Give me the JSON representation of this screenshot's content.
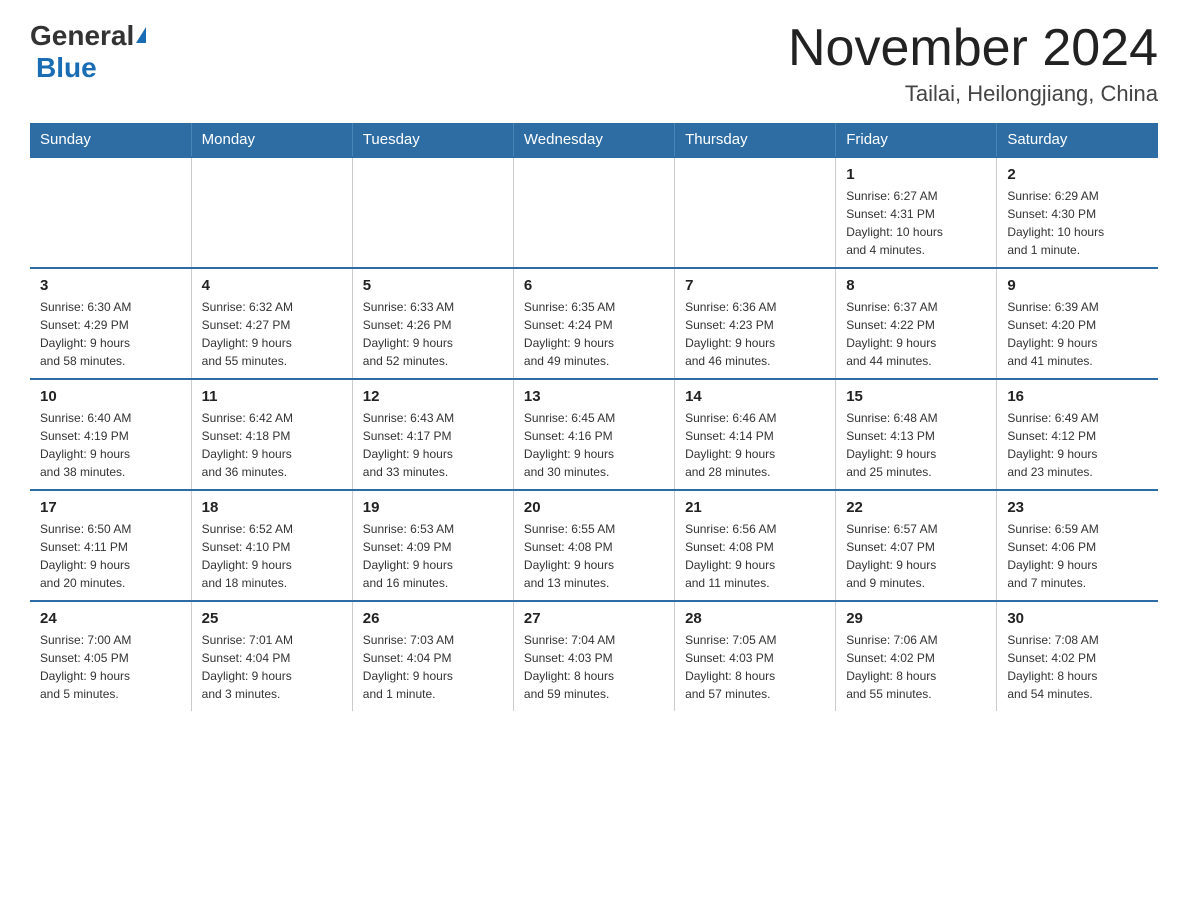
{
  "header": {
    "logo_general": "General",
    "logo_blue": "Blue",
    "month_year": "November 2024",
    "location": "Tailai, Heilongjiang, China"
  },
  "weekdays": [
    "Sunday",
    "Monday",
    "Tuesday",
    "Wednesday",
    "Thursday",
    "Friday",
    "Saturday"
  ],
  "weeks": [
    [
      {
        "day": "",
        "info": ""
      },
      {
        "day": "",
        "info": ""
      },
      {
        "day": "",
        "info": ""
      },
      {
        "day": "",
        "info": ""
      },
      {
        "day": "",
        "info": ""
      },
      {
        "day": "1",
        "info": "Sunrise: 6:27 AM\nSunset: 4:31 PM\nDaylight: 10 hours\nand 4 minutes."
      },
      {
        "day": "2",
        "info": "Sunrise: 6:29 AM\nSunset: 4:30 PM\nDaylight: 10 hours\nand 1 minute."
      }
    ],
    [
      {
        "day": "3",
        "info": "Sunrise: 6:30 AM\nSunset: 4:29 PM\nDaylight: 9 hours\nand 58 minutes."
      },
      {
        "day": "4",
        "info": "Sunrise: 6:32 AM\nSunset: 4:27 PM\nDaylight: 9 hours\nand 55 minutes."
      },
      {
        "day": "5",
        "info": "Sunrise: 6:33 AM\nSunset: 4:26 PM\nDaylight: 9 hours\nand 52 minutes."
      },
      {
        "day": "6",
        "info": "Sunrise: 6:35 AM\nSunset: 4:24 PM\nDaylight: 9 hours\nand 49 minutes."
      },
      {
        "day": "7",
        "info": "Sunrise: 6:36 AM\nSunset: 4:23 PM\nDaylight: 9 hours\nand 46 minutes."
      },
      {
        "day": "8",
        "info": "Sunrise: 6:37 AM\nSunset: 4:22 PM\nDaylight: 9 hours\nand 44 minutes."
      },
      {
        "day": "9",
        "info": "Sunrise: 6:39 AM\nSunset: 4:20 PM\nDaylight: 9 hours\nand 41 minutes."
      }
    ],
    [
      {
        "day": "10",
        "info": "Sunrise: 6:40 AM\nSunset: 4:19 PM\nDaylight: 9 hours\nand 38 minutes."
      },
      {
        "day": "11",
        "info": "Sunrise: 6:42 AM\nSunset: 4:18 PM\nDaylight: 9 hours\nand 36 minutes."
      },
      {
        "day": "12",
        "info": "Sunrise: 6:43 AM\nSunset: 4:17 PM\nDaylight: 9 hours\nand 33 minutes."
      },
      {
        "day": "13",
        "info": "Sunrise: 6:45 AM\nSunset: 4:16 PM\nDaylight: 9 hours\nand 30 minutes."
      },
      {
        "day": "14",
        "info": "Sunrise: 6:46 AM\nSunset: 4:14 PM\nDaylight: 9 hours\nand 28 minutes."
      },
      {
        "day": "15",
        "info": "Sunrise: 6:48 AM\nSunset: 4:13 PM\nDaylight: 9 hours\nand 25 minutes."
      },
      {
        "day": "16",
        "info": "Sunrise: 6:49 AM\nSunset: 4:12 PM\nDaylight: 9 hours\nand 23 minutes."
      }
    ],
    [
      {
        "day": "17",
        "info": "Sunrise: 6:50 AM\nSunset: 4:11 PM\nDaylight: 9 hours\nand 20 minutes."
      },
      {
        "day": "18",
        "info": "Sunrise: 6:52 AM\nSunset: 4:10 PM\nDaylight: 9 hours\nand 18 minutes."
      },
      {
        "day": "19",
        "info": "Sunrise: 6:53 AM\nSunset: 4:09 PM\nDaylight: 9 hours\nand 16 minutes."
      },
      {
        "day": "20",
        "info": "Sunrise: 6:55 AM\nSunset: 4:08 PM\nDaylight: 9 hours\nand 13 minutes."
      },
      {
        "day": "21",
        "info": "Sunrise: 6:56 AM\nSunset: 4:08 PM\nDaylight: 9 hours\nand 11 minutes."
      },
      {
        "day": "22",
        "info": "Sunrise: 6:57 AM\nSunset: 4:07 PM\nDaylight: 9 hours\nand 9 minutes."
      },
      {
        "day": "23",
        "info": "Sunrise: 6:59 AM\nSunset: 4:06 PM\nDaylight: 9 hours\nand 7 minutes."
      }
    ],
    [
      {
        "day": "24",
        "info": "Sunrise: 7:00 AM\nSunset: 4:05 PM\nDaylight: 9 hours\nand 5 minutes."
      },
      {
        "day": "25",
        "info": "Sunrise: 7:01 AM\nSunset: 4:04 PM\nDaylight: 9 hours\nand 3 minutes."
      },
      {
        "day": "26",
        "info": "Sunrise: 7:03 AM\nSunset: 4:04 PM\nDaylight: 9 hours\nand 1 minute."
      },
      {
        "day": "27",
        "info": "Sunrise: 7:04 AM\nSunset: 4:03 PM\nDaylight: 8 hours\nand 59 minutes."
      },
      {
        "day": "28",
        "info": "Sunrise: 7:05 AM\nSunset: 4:03 PM\nDaylight: 8 hours\nand 57 minutes."
      },
      {
        "day": "29",
        "info": "Sunrise: 7:06 AM\nSunset: 4:02 PM\nDaylight: 8 hours\nand 55 minutes."
      },
      {
        "day": "30",
        "info": "Sunrise: 7:08 AM\nSunset: 4:02 PM\nDaylight: 8 hours\nand 54 minutes."
      }
    ]
  ]
}
